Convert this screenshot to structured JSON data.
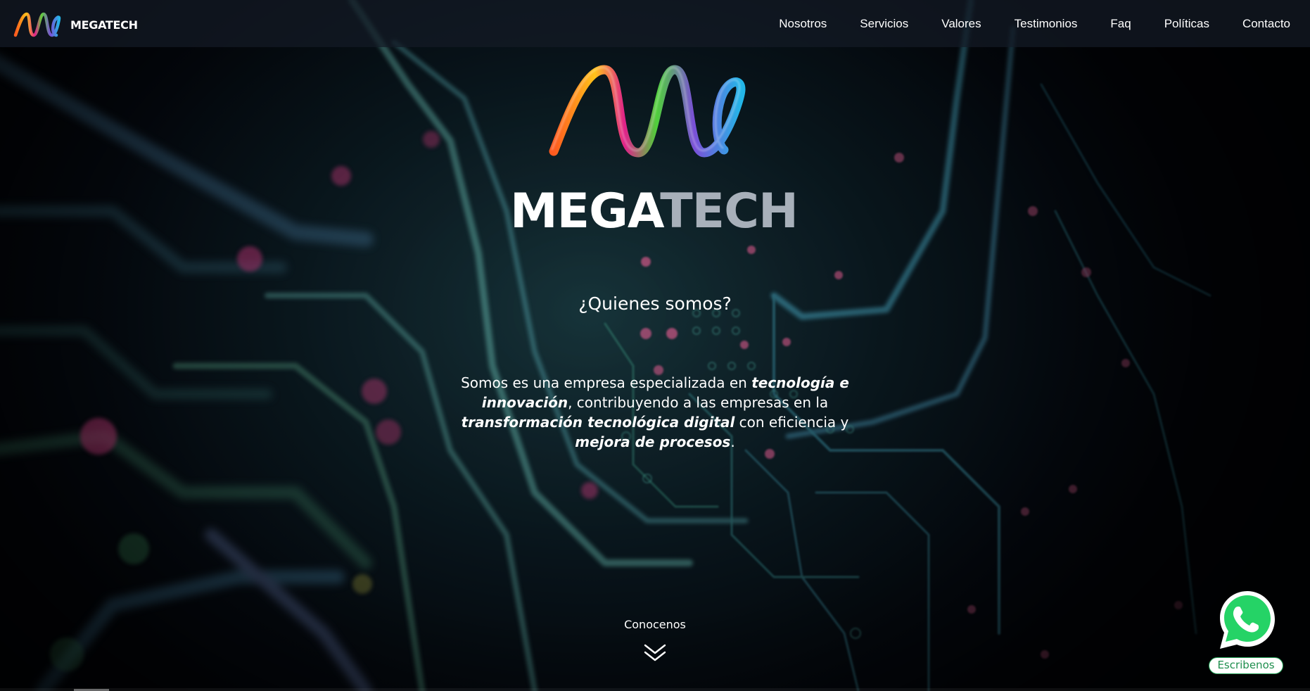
{
  "header": {
    "brand": "MEGATECH",
    "nav": [
      "Nosotros",
      "Servicios",
      "Valores",
      "Testimonios",
      "Faq",
      "Políticas",
      "Contacto"
    ]
  },
  "hero": {
    "wordmark_part1": "MEGA",
    "wordmark_part2": "TECH",
    "heading": "¿Quienes somos?",
    "paragraph": {
      "t1": "Somos es una empresa especializada en ",
      "b1": "tecnología e innovación",
      "t2": ", contribuyendo a las empresas en la ",
      "b2": "transformación tecnológica digital",
      "t3": " con eficiencia y ",
      "b3": "mejora de procesos",
      "t4": "."
    },
    "cta_label": "Conocenos"
  },
  "whatsapp": {
    "label": "Escribenos"
  },
  "icons": {
    "brand_logo": "rainbow-wave-logo",
    "cta": "double-chevron-down-icon",
    "whatsapp": "whatsapp-icon"
  },
  "colors": {
    "accent_whatsapp": "#25D366",
    "wordmark_tech": "#a8b0ba"
  }
}
